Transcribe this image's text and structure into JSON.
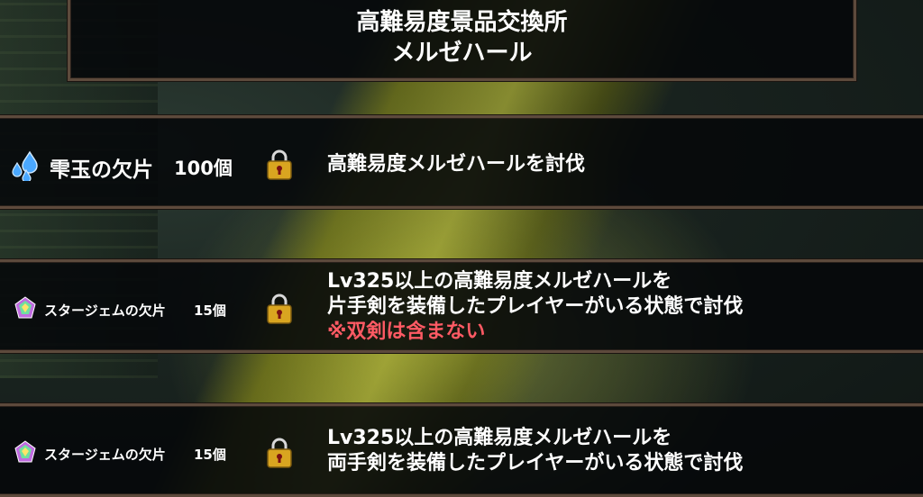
{
  "header": {
    "title_line1": "高難易度景品交換所",
    "title_line2": "メルゼハール"
  },
  "rewards": [
    {
      "item": "雫玉の欠片",
      "quantity": "100個",
      "icon": "water-drops-icon",
      "status_icon": "padlock-icon",
      "condition_lines": [
        "高難易度メルゼハールを討伐"
      ],
      "note": ""
    },
    {
      "item": "スタージェムの欠片",
      "quantity": "15個",
      "icon": "star-gem-icon",
      "status_icon": "padlock-icon",
      "condition_lines": [
        "Lv325以上の高難易度メルゼハールを",
        "片手剣を装備したプレイヤーがいる状態で討伐"
      ],
      "note": "※双剣は含まない"
    },
    {
      "item": "スタージェムの欠片",
      "quantity": "15個",
      "icon": "star-gem-icon",
      "status_icon": "padlock-icon",
      "condition_lines": [
        "Lv325以上の高難易度メルゼハールを",
        "両手剣を装備したプレイヤーがいる状態で討伐"
      ],
      "note": ""
    }
  ],
  "colors": {
    "border": "#5d4a3c",
    "note": "#ff5a64",
    "lock_gold": "#d9a520"
  }
}
